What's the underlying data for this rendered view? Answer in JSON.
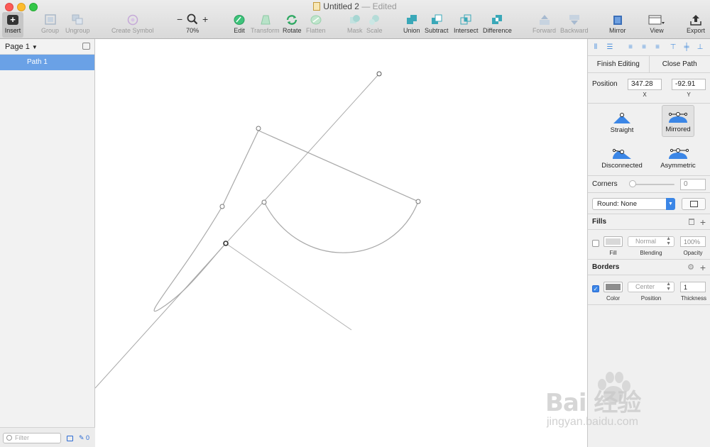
{
  "window": {
    "title": "Untitled 2",
    "separator": "—",
    "status": "Edited"
  },
  "toolbar": {
    "insert": "Insert",
    "group": "Group",
    "ungroup": "Ungroup",
    "create_symbol": "Create Symbol",
    "zoom_minus": "−",
    "zoom_plus": "+",
    "zoom_value": "70%",
    "edit": "Edit",
    "transform": "Transform",
    "rotate": "Rotate",
    "flatten": "Flatten",
    "mask": "Mask",
    "scale": "Scale",
    "union": "Union",
    "subtract": "Subtract",
    "intersect": "Intersect",
    "difference": "Difference",
    "forward": "Forward",
    "backward": "Backward",
    "mirror": "Mirror",
    "view": "View",
    "export": "Export",
    "accent_color": "#3aa8b8"
  },
  "sidebar": {
    "page_label": "Page 1",
    "layers": [
      {
        "label": "Path 1",
        "selected": true
      }
    ],
    "filter_placeholder": "Filter",
    "edit_count": "0",
    "selection_color": "#6aa1e6"
  },
  "inspector": {
    "finish_editing": "Finish Editing",
    "close_path": "Close Path",
    "position_label": "Position",
    "x_value": "347.28",
    "y_value": "-92.91",
    "x_label": "X",
    "y_label": "Y",
    "point_types": [
      {
        "label": "Straight",
        "selected": false
      },
      {
        "label": "Mirrored",
        "selected": true
      },
      {
        "label": "Disconnected",
        "selected": false
      },
      {
        "label": "Asymmetric",
        "selected": false
      }
    ],
    "corners_label": "Corners",
    "corners_value": "0",
    "round_select": "Round: None",
    "fills": {
      "title": "Fills",
      "enabled": false,
      "blending": "Normal",
      "opacity": "100%",
      "fill_label": "Fill",
      "blending_label": "Blending",
      "opacity_label": "Opacity",
      "swatch_color": "#d8d8d8"
    },
    "borders": {
      "title": "Borders",
      "enabled": true,
      "position": "Center",
      "thickness": "1",
      "color_label": "Color",
      "position_label": "Position",
      "thickness_label": "Thickness",
      "swatch_color": "#8e8e8e"
    },
    "point_icon_color": "#3b86e6"
  },
  "watermark": {
    "main": "Bai 经验",
    "sub": "jingyan.baidu.com"
  }
}
